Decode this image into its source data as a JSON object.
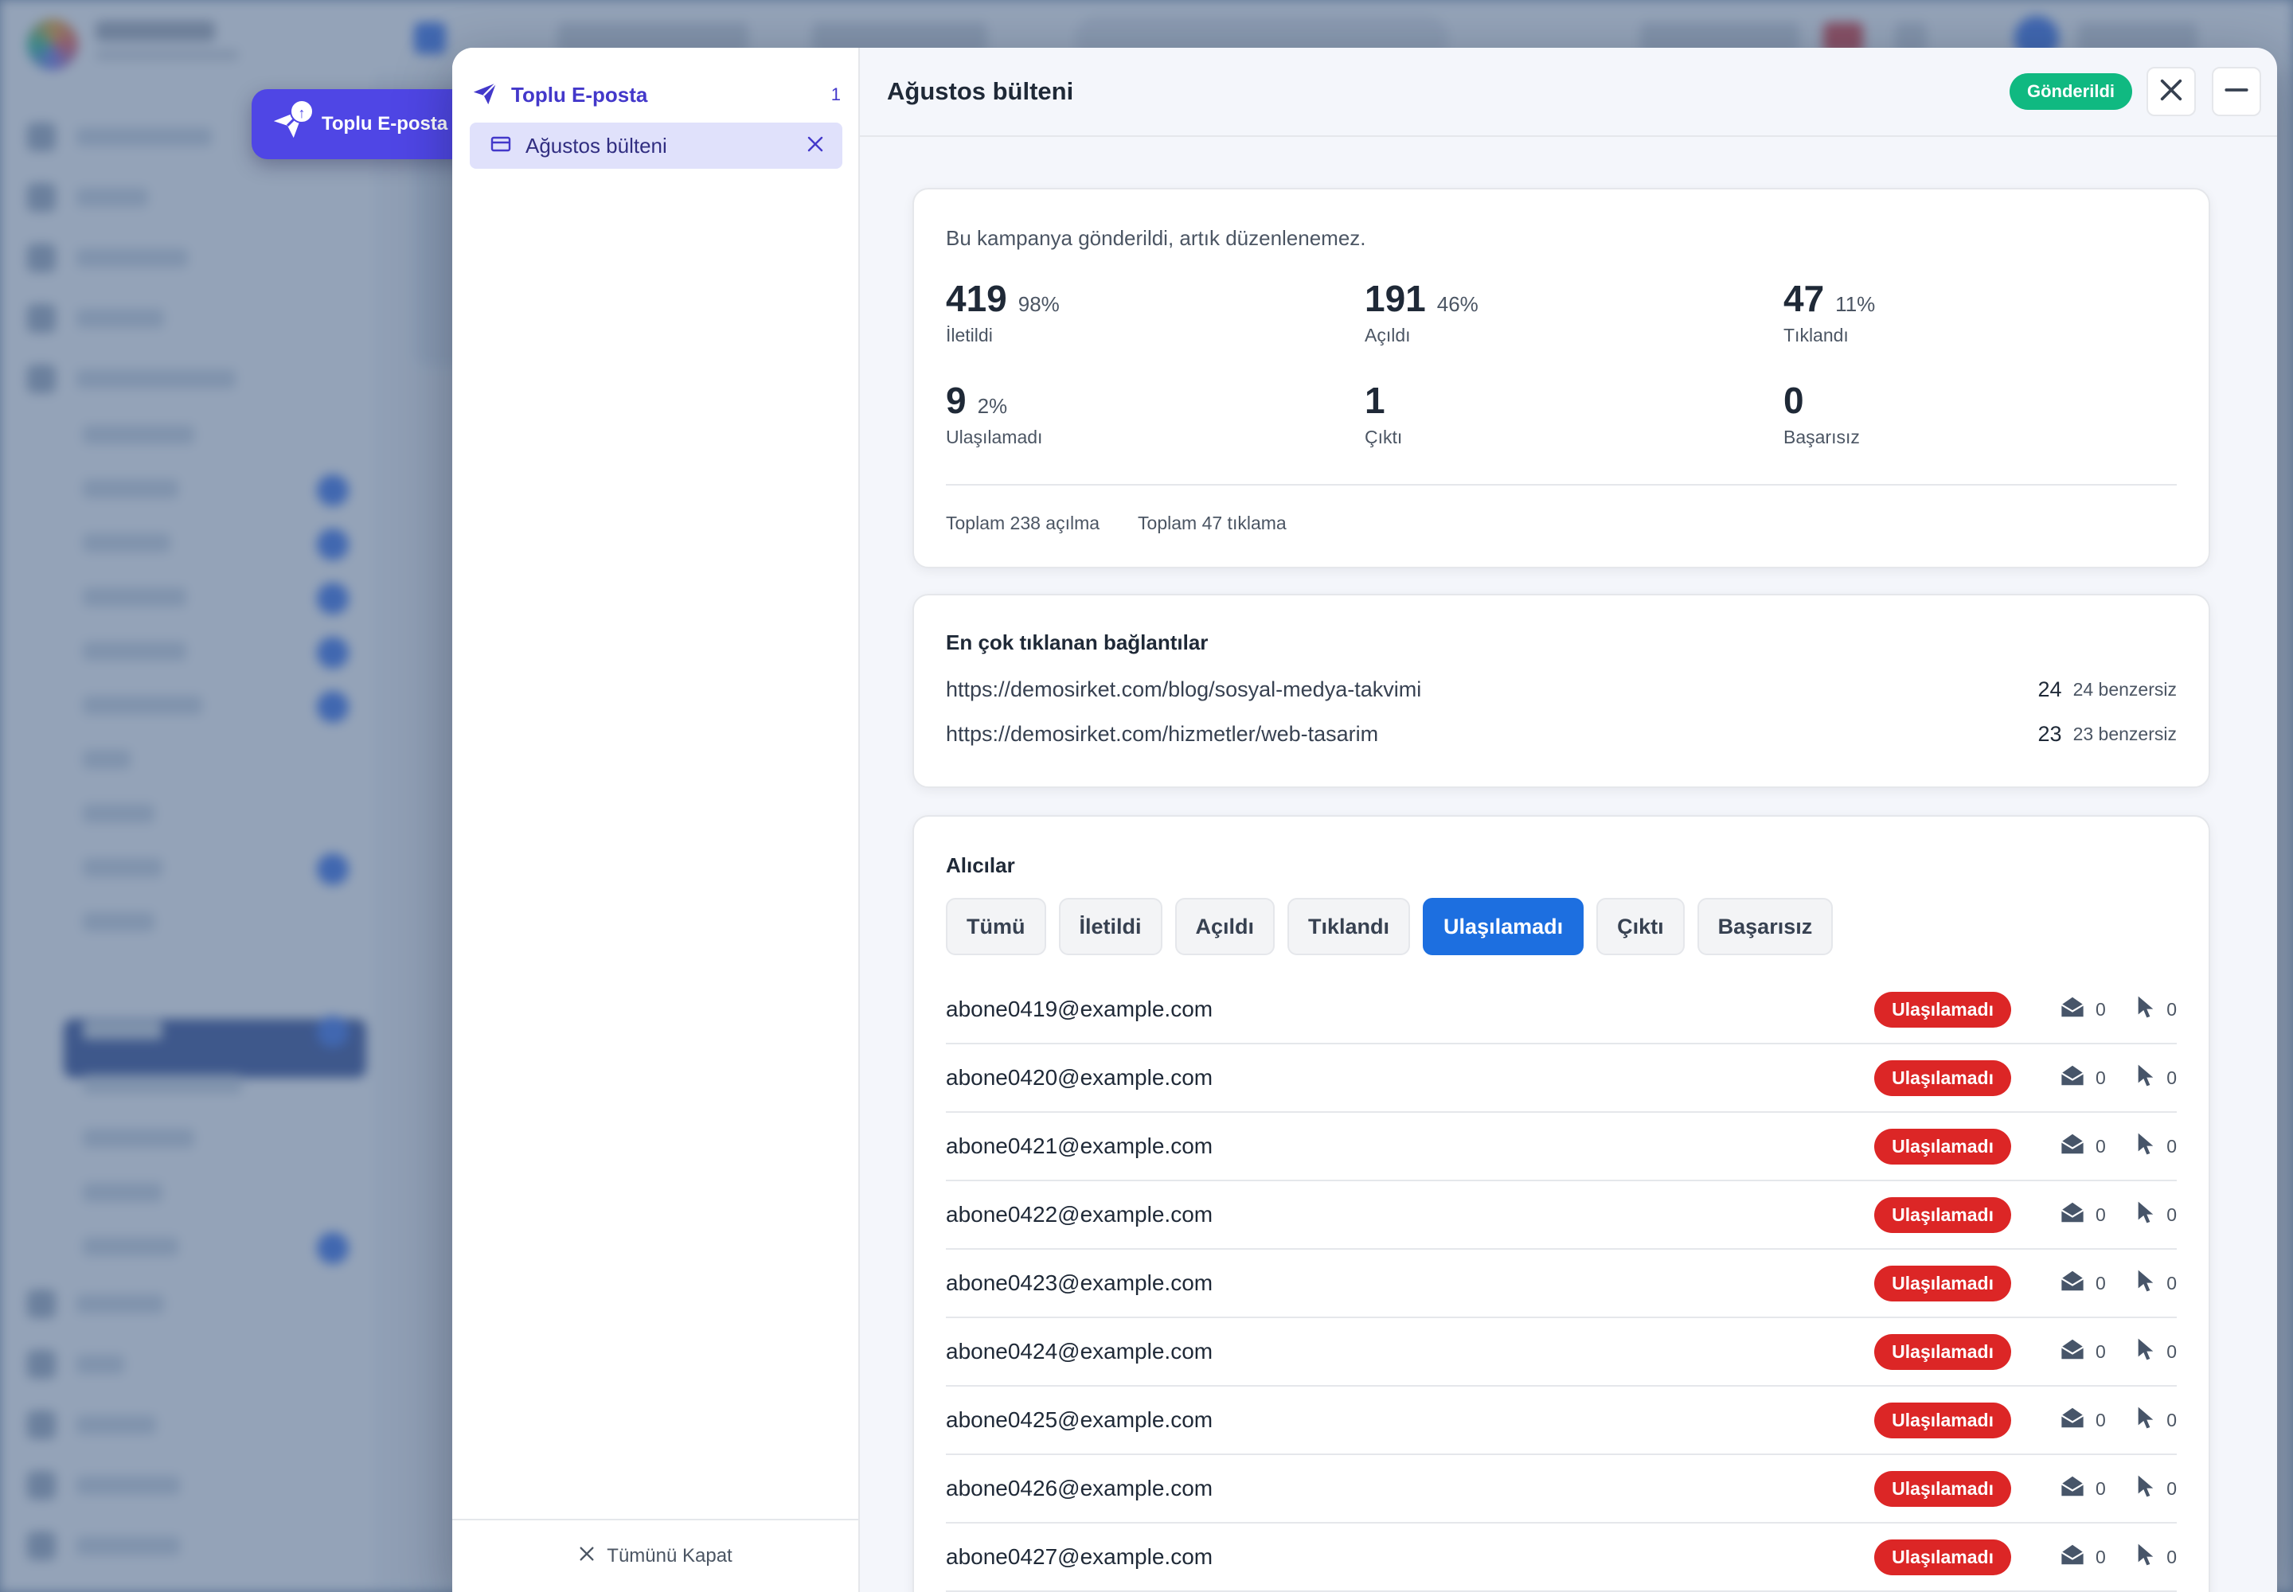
{
  "minimized": {
    "label": "Toplu E-posta"
  },
  "left_pane": {
    "group_title": "Toplu E-posta",
    "group_count": "1",
    "item_label": "Ağustos bülteni",
    "close_all": "Tümünü Kapat"
  },
  "header": {
    "title": "Ağustos bülteni",
    "status": "Gönderildi"
  },
  "summary": {
    "notice": "Bu kampanya gönderildi, artık düzenlenemez.",
    "stats": [
      {
        "value": "419",
        "percent": "98%",
        "label": "İletildi"
      },
      {
        "value": "191",
        "percent": "46%",
        "label": "Açıldı"
      },
      {
        "value": "47",
        "percent": "11%",
        "label": "Tıklandı"
      },
      {
        "value": "9",
        "percent": "2%",
        "label": "Ulaşılamadı"
      },
      {
        "value": "1",
        "percent": "",
        "label": "Çıktı"
      },
      {
        "value": "0",
        "percent": "",
        "label": "Başarısız"
      }
    ],
    "total_opens": "Toplam 238 açılma",
    "total_clicks": "Toplam 47 tıklama"
  },
  "links": {
    "title": "En çok tıklanan bağlantılar",
    "items": [
      {
        "url": "https://demosirket.com/blog/sosyal-medya-takvimi",
        "count": "24",
        "unique": "24 benzersiz"
      },
      {
        "url": "https://demosirket.com/hizmetler/web-tasarim",
        "count": "23",
        "unique": "23 benzersiz"
      }
    ]
  },
  "recipients": {
    "title": "Alıcılar",
    "filters": [
      "Tümü",
      "İletildi",
      "Açıldı",
      "Tıklandı",
      "Ulaşılamadı",
      "Çıktı",
      "Başarısız"
    ],
    "active_filter": "Ulaşılamadı",
    "rows": [
      {
        "email": "abone0419@example.com",
        "status": "Ulaşılamadı",
        "opens": "0",
        "clicks": "0"
      },
      {
        "email": "abone0420@example.com",
        "status": "Ulaşılamadı",
        "opens": "0",
        "clicks": "0"
      },
      {
        "email": "abone0421@example.com",
        "status": "Ulaşılamadı",
        "opens": "0",
        "clicks": "0"
      },
      {
        "email": "abone0422@example.com",
        "status": "Ulaşılamadı",
        "opens": "0",
        "clicks": "0"
      },
      {
        "email": "abone0423@example.com",
        "status": "Ulaşılamadı",
        "opens": "0",
        "clicks": "0"
      },
      {
        "email": "abone0424@example.com",
        "status": "Ulaşılamadı",
        "opens": "0",
        "clicks": "0"
      },
      {
        "email": "abone0425@example.com",
        "status": "Ulaşılamadı",
        "opens": "0",
        "clicks": "0"
      },
      {
        "email": "abone0426@example.com",
        "status": "Ulaşılamadı",
        "opens": "0",
        "clicks": "0"
      },
      {
        "email": "abone0427@example.com",
        "status": "Ulaşılamadı",
        "opens": "0",
        "clicks": "0"
      }
    ]
  },
  "colors": {
    "accent": "#4f46e5",
    "sent": "#10b981",
    "bounced": "#dc2626",
    "active_filter": "#1d6fe0"
  },
  "icons": {
    "group": "paper-plane-icon",
    "item": "card-icon",
    "close": "close-icon",
    "minimize": "minimize-icon",
    "opens": "envelope-open-icon",
    "clicks": "cursor-icon"
  }
}
